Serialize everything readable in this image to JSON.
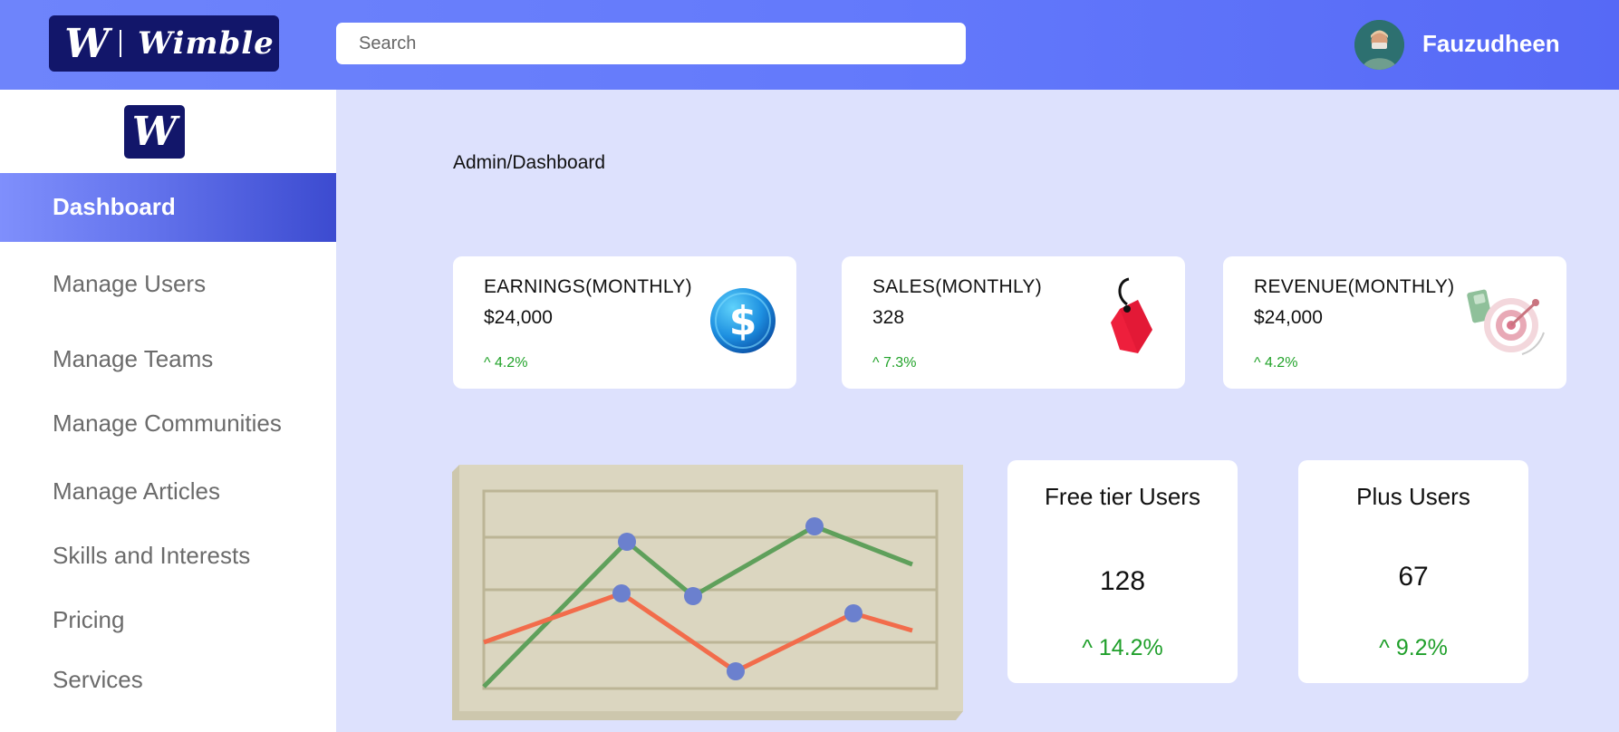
{
  "header": {
    "logo_mark": "W",
    "logo_text": "Wimble",
    "search_placeholder": "Search",
    "username": "Fauzudheen"
  },
  "sidebar": {
    "logo_mark": "W",
    "active": "Dashboard",
    "items": [
      {
        "label": "Manage Users"
      },
      {
        "label": "Manage Teams"
      },
      {
        "label": "Manage Communities"
      },
      {
        "label": "Manage Articles"
      },
      {
        "label": "Skills and Interests"
      },
      {
        "label": "Pricing"
      },
      {
        "label": "Services"
      }
    ]
  },
  "breadcrumb": "Admin/Dashboard",
  "stats": [
    {
      "title": "EARNINGS(MONTHLY)",
      "value": "$24,000",
      "change": "^ 4.2%",
      "icon": "dollar-coin-icon"
    },
    {
      "title": "SALES(MONTHLY)",
      "value": "328",
      "change": "^  7.3%",
      "icon": "price-tag-icon"
    },
    {
      "title": "REVENUE(MONTHLY)",
      "value": "$24,000",
      "change": "^ 4.2%",
      "icon": "target-money-icon"
    }
  ],
  "user_cards": [
    {
      "title": "Free tier Users",
      "value": "128",
      "change": "^ 14.2%"
    },
    {
      "title": "Plus Users",
      "value": "67",
      "change": "^ 9.2%"
    }
  ],
  "colors": {
    "accent": "#5669f6",
    "brand_dark": "#12166a",
    "positive": "#22a32a",
    "background": "#dde1fd"
  }
}
